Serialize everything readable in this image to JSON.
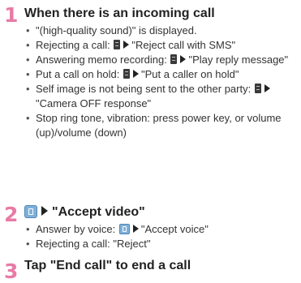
{
  "steps": [
    {
      "number": "1",
      "title": "When there is an incoming call",
      "bullets": [
        {
          "text": "\"(high-quality sound)\" is displayed."
        },
        {
          "pre": "Rejecting a call: ",
          "post": "\"Reject call with SMS\""
        },
        {
          "pre": "Answering memo recording: ",
          "post": "\"Play reply message\""
        },
        {
          "pre": "Put a call on hold: ",
          "post": "\"Put a caller on hold\""
        },
        {
          "pre": "Self image is not being sent to the other party: ",
          "post": "\"Camera OFF response\""
        },
        {
          "text": "Stop ring tone, vibration: press power key, or volume (up)/volume (down)"
        }
      ]
    },
    {
      "number": "2",
      "title_suffix": "\"Accept video\"",
      "bullets": [
        {
          "pre": "Answer by voice: ",
          "post": "\"Accept voice\""
        },
        {
          "text": "Rejecting a call: \"Reject\""
        }
      ]
    },
    {
      "number": "3",
      "title": "Tap \"End call\" to end a call"
    }
  ],
  "colors": {
    "step_number": "#e87aa6",
    "icon_blue": "#7fb0d8"
  },
  "icons": {
    "menu_key": "menu-key-icon",
    "arrow": "arrow-right-icon",
    "video_call": "video-call-icon"
  }
}
